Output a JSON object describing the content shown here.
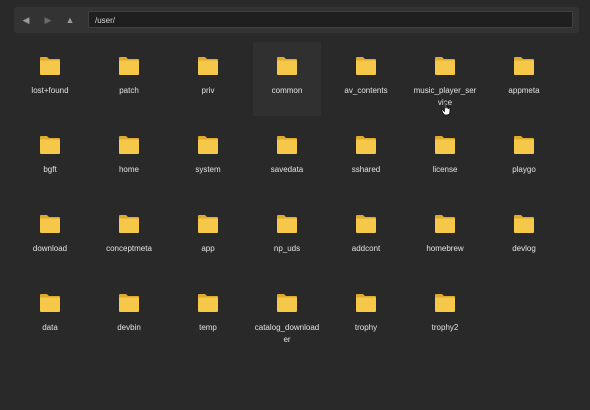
{
  "toolbar": {
    "back_icon": "back-arrow-icon",
    "forward_icon": "forward-arrow-icon",
    "up_icon": "up-arrow-icon",
    "back_glyph": "◀",
    "forward_glyph": "▶",
    "up_glyph": "▲",
    "path": "/user/"
  },
  "colors": {
    "background": "#292929",
    "folder": "#f5c84a",
    "folder_tab": "#e0aa2e",
    "label": "#e2e2e2"
  },
  "items": [
    {
      "label": "lost+found"
    },
    {
      "label": "patch"
    },
    {
      "label": "priv"
    },
    {
      "label": "common"
    },
    {
      "label": "av_contents"
    },
    {
      "label": "music_player_service"
    },
    {
      "label": "appmeta"
    },
    {
      "label": "bgft"
    },
    {
      "label": "home"
    },
    {
      "label": "system"
    },
    {
      "label": "savedata"
    },
    {
      "label": "sshared"
    },
    {
      "label": "license"
    },
    {
      "label": "playgo"
    },
    {
      "label": "download"
    },
    {
      "label": "conceptmeta"
    },
    {
      "label": "app"
    },
    {
      "label": "np_uds"
    },
    {
      "label": "addcont"
    },
    {
      "label": "homebrew"
    },
    {
      "label": "devlog"
    },
    {
      "label": "data"
    },
    {
      "label": "devbin"
    },
    {
      "label": "temp"
    },
    {
      "label": "catalog_downloader"
    },
    {
      "label": "trophy"
    },
    {
      "label": "trophy2"
    }
  ],
  "hovered_item": "common",
  "pointer_icon": "hand-pointer-icon"
}
